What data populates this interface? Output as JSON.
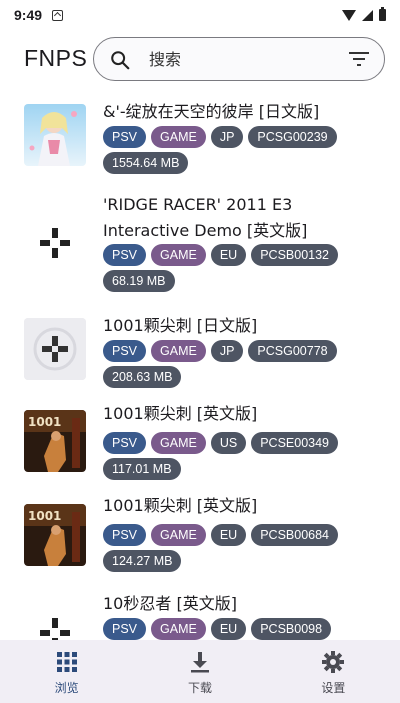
{
  "status_bar": {
    "time": "9:49"
  },
  "header": {
    "title": "FNPS"
  },
  "search": {
    "placeholder": "搜索"
  },
  "items": [
    {
      "title": "&'-绽放在天空的彼岸 [日文版]",
      "platform": "PSV",
      "type": "GAME",
      "region": "JP",
      "code": "PCSG00239",
      "size": "1554.64 MB"
    },
    {
      "title": "'RIDGE RACER' 2011 E3 Interactive Demo [英文版]",
      "platform": "PSV",
      "type": "GAME",
      "region": "EU",
      "code": "PCSB00132",
      "size": "68.19 MB"
    },
    {
      "title": "1001颗尖刺 [日文版]",
      "platform": "PSV",
      "type": "GAME",
      "region": "JP",
      "code": "PCSG00778",
      "size": "208.63 MB"
    },
    {
      "title": "1001颗尖刺 [英文版]",
      "platform": "PSV",
      "type": "GAME",
      "region": "US",
      "code": "PCSE00349",
      "size": "117.01 MB"
    },
    {
      "title": "1001颗尖刺 [英文版]",
      "platform": "PSV",
      "type": "GAME",
      "region": "EU",
      "code": "PCSB00684",
      "size": "124.27 MB"
    },
    {
      "title": "10秒忍者 [英文版]",
      "platform": "PSV",
      "type": "GAME",
      "region": "EU",
      "code": "PCSB0098",
      "size": ""
    }
  ],
  "bottom_nav": {
    "browse": "浏览",
    "download": "下载",
    "settings": "设置"
  },
  "colors": {
    "chip_psv": "#3a5a8c",
    "chip_game": "#7a5a8c",
    "chip_default": "#4e5563",
    "nav_bg": "#f1eef5"
  }
}
